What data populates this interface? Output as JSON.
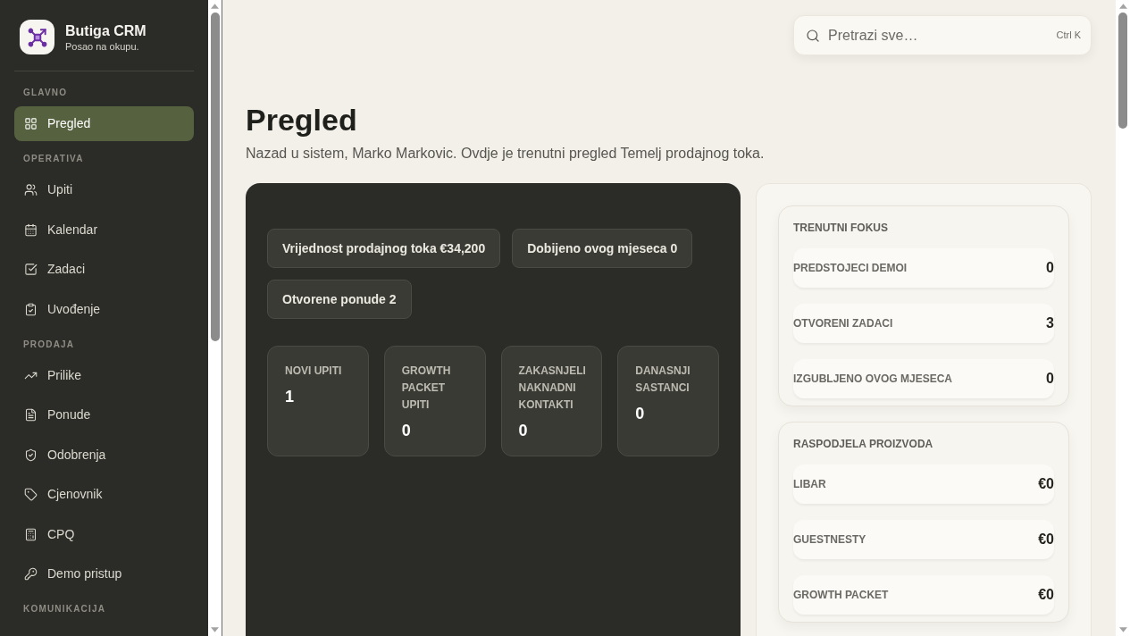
{
  "sidebar": {
    "brand": {
      "name": "Butiga CRM",
      "tagline": "Posao na okupu."
    },
    "sections": [
      {
        "title": "GLAVNO",
        "items": [
          {
            "label": "Pregled",
            "selected": true
          }
        ]
      },
      {
        "title": "OPERATIVA",
        "items": [
          {
            "label": "Upiti",
            "selected": false
          },
          {
            "label": "Kalendar",
            "selected": false
          },
          {
            "label": "Zadaci",
            "selected": false
          },
          {
            "label": "Uvođenje",
            "selected": false
          }
        ]
      },
      {
        "title": "PRODAJA",
        "items": [
          {
            "label": "Prilike",
            "selected": false
          },
          {
            "label": "Ponude",
            "selected": false
          },
          {
            "label": "Odobrenja",
            "selected": false
          },
          {
            "label": "Cjenovnik",
            "selected": false
          },
          {
            "label": "CPQ",
            "selected": false
          },
          {
            "label": "Demo pristup",
            "selected": false
          }
        ]
      },
      {
        "title": "KOMUNIKACIJA"
      }
    ]
  },
  "search": {
    "placeholder": "Pretrazi sve…",
    "shortcut": "Ctrl K"
  },
  "page": {
    "title": "Pregled",
    "subtitle": "Nazad u sistem, Marko Markovic. Ovdje je trenutni pregled Temelj prodajnog toka."
  },
  "summary_card": {
    "chips": [
      "Vrijednost prodajnog toka €34,200",
      "Dobijeno ovog mjeseca 0",
      "Otvorene ponude 2"
    ],
    "stats": [
      {
        "label": "NOVI UPITI",
        "value": "1"
      },
      {
        "label": "GROWTH PACKET UPITI",
        "value": "0"
      },
      {
        "label": "ZAKASNJELI NAKNADNI KONTAKTI",
        "value": "0"
      },
      {
        "label": "DANASNJI SASTANCI",
        "value": "0"
      }
    ]
  },
  "side_panel": {
    "sections": [
      {
        "title": "TRENUTNI FOKUS",
        "rows": [
          {
            "label": "PREDSTOJECI DEMOI",
            "value": "0"
          },
          {
            "label": "OTVORENI ZADACI",
            "value": "3"
          },
          {
            "label": "IZGUBLJENO OVOG MJESECA",
            "value": "0"
          }
        ]
      },
      {
        "title": "RASPODJELA PROIZVODA",
        "rows": [
          {
            "label": "LIBAR",
            "value": "€0"
          },
          {
            "label": "GUESTNESTY",
            "value": "€0"
          },
          {
            "label": "GROWTH PACKET",
            "value": "€0"
          }
        ]
      }
    ]
  }
}
